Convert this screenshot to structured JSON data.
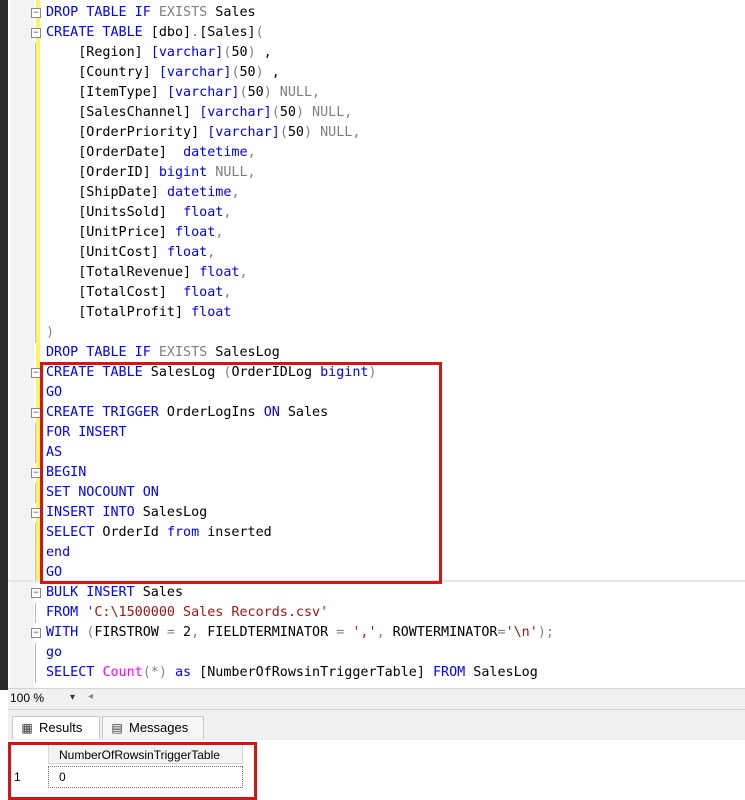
{
  "editor": {
    "lines": [
      [
        [
          "kw",
          "DROP TABLE IF "
        ],
        [
          "gr",
          "EXISTS"
        ],
        [
          "tx",
          " Sales"
        ]
      ],
      [
        [
          "kw",
          "CREATE TABLE"
        ],
        [
          "tx",
          " [dbo]"
        ],
        [
          "gr",
          "."
        ],
        [
          "tx",
          "[Sales]"
        ],
        [
          "gr",
          "("
        ]
      ],
      [
        [
          "tx",
          "    [Region] "
        ],
        [
          "ty",
          "[varchar]"
        ],
        [
          "gr",
          "("
        ],
        [
          "tx",
          "50"
        ],
        [
          "gr",
          ")"
        ],
        [
          "tx",
          " ,"
        ]
      ],
      [
        [
          "tx",
          "    [Country] "
        ],
        [
          "ty",
          "[varchar]"
        ],
        [
          "gr",
          "("
        ],
        [
          "tx",
          "50"
        ],
        [
          "gr",
          ")"
        ],
        [
          "tx",
          " ,"
        ]
      ],
      [
        [
          "tx",
          "    [ItemType] "
        ],
        [
          "ty",
          "[varchar]"
        ],
        [
          "gr",
          "("
        ],
        [
          "tx",
          "50"
        ],
        [
          "gr",
          ") NULL,"
        ]
      ],
      [
        [
          "tx",
          "    [SalesChannel] "
        ],
        [
          "ty",
          "[varchar]"
        ],
        [
          "gr",
          "("
        ],
        [
          "tx",
          "50"
        ],
        [
          "gr",
          ") NULL,"
        ]
      ],
      [
        [
          "tx",
          "    [OrderPriority] "
        ],
        [
          "ty",
          "[varchar]"
        ],
        [
          "gr",
          "("
        ],
        [
          "tx",
          "50"
        ],
        [
          "gr",
          ") NULL,"
        ]
      ],
      [
        [
          "tx",
          "    [OrderDate]  "
        ],
        [
          "ty",
          "datetime"
        ],
        [
          "gr",
          ","
        ]
      ],
      [
        [
          "tx",
          "    [OrderID] "
        ],
        [
          "ty",
          "bigint"
        ],
        [
          "gr",
          " NULL,"
        ]
      ],
      [
        [
          "tx",
          "    [ShipDate] "
        ],
        [
          "ty",
          "datetime"
        ],
        [
          "gr",
          ","
        ]
      ],
      [
        [
          "tx",
          "    [UnitsSold]  "
        ],
        [
          "ty",
          "float"
        ],
        [
          "gr",
          ","
        ]
      ],
      [
        [
          "tx",
          "    [UnitPrice] "
        ],
        [
          "ty",
          "float"
        ],
        [
          "gr",
          ","
        ]
      ],
      [
        [
          "tx",
          "    [UnitCost] "
        ],
        [
          "ty",
          "float"
        ],
        [
          "gr",
          ","
        ]
      ],
      [
        [
          "tx",
          "    [TotalRevenue] "
        ],
        [
          "ty",
          "float"
        ],
        [
          "gr",
          ","
        ]
      ],
      [
        [
          "tx",
          "    [TotalCost]  "
        ],
        [
          "ty",
          "float"
        ],
        [
          "gr",
          ","
        ]
      ],
      [
        [
          "tx",
          "    [TotalProfit] "
        ],
        [
          "ty",
          "float"
        ]
      ],
      [
        [
          "gr",
          ")"
        ]
      ],
      [
        [
          "kw",
          "DROP TABLE IF "
        ],
        [
          "gr",
          "EXISTS"
        ],
        [
          "tx",
          " SalesLog"
        ]
      ],
      [
        [
          "kw",
          "CREATE TABLE"
        ],
        [
          "tx",
          " SalesLog "
        ],
        [
          "gr",
          "("
        ],
        [
          "tx",
          "OrderIDLog "
        ],
        [
          "ty",
          "bigint"
        ],
        [
          "gr",
          ")"
        ]
      ],
      [
        [
          "kw",
          "GO"
        ]
      ],
      [
        [
          "kw",
          "CREATE TRIGGER"
        ],
        [
          "tx",
          " OrderLogIns "
        ],
        [
          "kw",
          "ON"
        ],
        [
          "tx",
          " Sales"
        ]
      ],
      [
        [
          "kw",
          "FOR INSERT"
        ]
      ],
      [
        [
          "kw",
          "AS"
        ]
      ],
      [
        [
          "kw",
          "BEGIN"
        ]
      ],
      [
        [
          "kw",
          "SET NOCOUNT ON"
        ]
      ],
      [
        [
          "kw",
          "INSERT INTO"
        ],
        [
          "tx",
          " SalesLog"
        ]
      ],
      [
        [
          "kw",
          "SELECT"
        ],
        [
          "tx",
          " OrderId "
        ],
        [
          "kw",
          "from"
        ],
        [
          "tx",
          " inserted"
        ]
      ],
      [
        [
          "kw",
          "end"
        ]
      ],
      [
        [
          "kw",
          "GO"
        ]
      ],
      [
        [
          "kw",
          "BULK INSERT"
        ],
        [
          "tx",
          " Sales"
        ]
      ],
      [
        [
          "kw",
          "FROM "
        ],
        [
          "st",
          "'C:\\1500000 Sales Records.csv'"
        ]
      ],
      [
        [
          "kw",
          "WITH "
        ],
        [
          "gr",
          "("
        ],
        [
          "tx",
          "FIRSTROW "
        ],
        [
          "gr",
          "="
        ],
        [
          "tx",
          " 2"
        ],
        [
          "gr",
          ","
        ],
        [
          "tx",
          " FIELDTERMINATOR "
        ],
        [
          "gr",
          "="
        ],
        [
          "tx",
          " "
        ],
        [
          "st",
          "','"
        ],
        [
          "gr",
          ","
        ],
        [
          "tx",
          " ROWTERMINATOR"
        ],
        [
          "gr",
          "="
        ],
        [
          "st",
          "'\\n'"
        ],
        [
          "gr",
          ");"
        ]
      ],
      [
        [
          "kw",
          "go"
        ]
      ],
      [
        [
          "kw",
          "SELECT "
        ],
        [
          "fn",
          "Count"
        ],
        [
          "gr",
          "(*)"
        ],
        [
          "tx",
          " "
        ],
        [
          "kw",
          "as"
        ],
        [
          "tx",
          " [NumberOfRowsinTriggerTable] "
        ],
        [
          "kw",
          "FROM"
        ],
        [
          "tx",
          " SalesLog"
        ]
      ]
    ]
  },
  "zoom": {
    "value": "100 %",
    "dropdown_icon": "chevron-down-icon"
  },
  "tabs": {
    "results": "Results",
    "messages": "Messages"
  },
  "grid": {
    "columns": [
      "NumberOfRowsinTriggerTable"
    ],
    "rows": [
      {
        "num": "1",
        "cells": [
          "0"
        ]
      }
    ]
  },
  "colors": {
    "highlight": "#d01717",
    "keyword": "#0000ff",
    "string": "#a31515",
    "function": "#ff00ff",
    "gray": "#808080"
  }
}
